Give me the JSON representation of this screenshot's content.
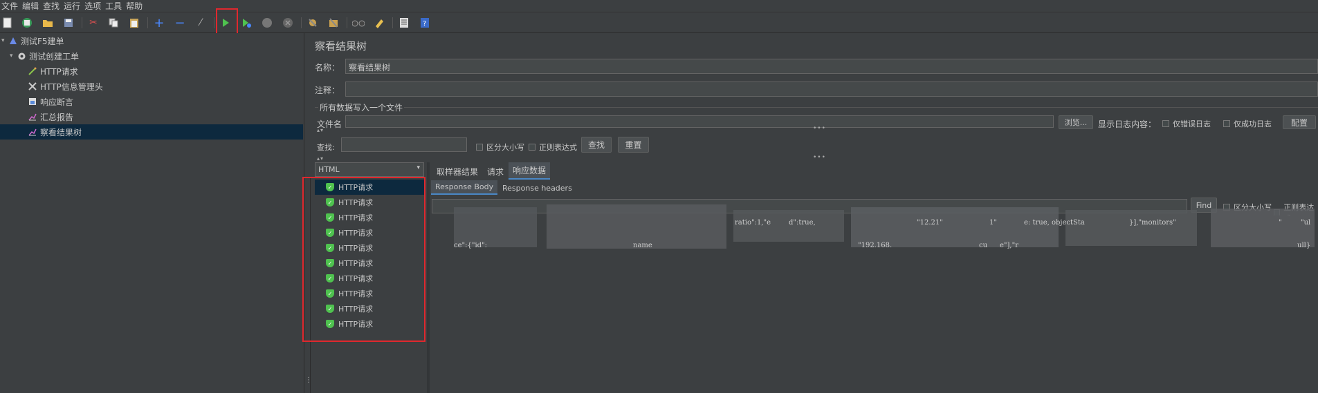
{
  "menu": [
    "文件",
    "编辑",
    "查找",
    "运行",
    "选项",
    "工具",
    "帮助"
  ],
  "toolbar": {
    "icons": [
      "new-icon",
      "templates-icon",
      "open-icon",
      "save-icon",
      "cut-icon",
      "copy-icon",
      "paste-icon",
      "expand-icon",
      "collapse-icon",
      "toggle-icon",
      "start-icon",
      "start-no-pause-icon",
      "stop-icon",
      "shutdown-icon",
      "clear-icon",
      "clear-all-icon",
      "search-icon",
      "reset-search-icon",
      "function-helper-icon",
      "help-icon"
    ]
  },
  "tree": {
    "items": [
      {
        "label": "测试F5建单",
        "level": 0,
        "icon": "test-plan-icon"
      },
      {
        "label": "测试创建工单",
        "level": 1,
        "icon": "thread-group-icon"
      },
      {
        "label": "HTTP请求",
        "level": 2,
        "icon": "http-sampler-icon"
      },
      {
        "label": "HTTP信息管理头",
        "level": 2,
        "icon": "header-manager-icon"
      },
      {
        "label": "响应断言",
        "level": 2,
        "icon": "assertion-icon"
      },
      {
        "label": "汇总报告",
        "level": 2,
        "icon": "summary-report-icon"
      },
      {
        "label": "察看结果树",
        "level": 2,
        "icon": "results-tree-icon",
        "selected": true
      }
    ]
  },
  "panel": {
    "title": "察看结果树",
    "name_label": "名称：",
    "name_value": "察看结果树",
    "comment_label": "注释：",
    "comment_value": "",
    "write_all_label": "所有数据写入一个文件",
    "filename_label": "文件名",
    "browse_label": "浏览...",
    "log_label": "显示日志内容：",
    "errors_only": "仅错误日志",
    "success_only": "仅成功日志",
    "config_label": "配置",
    "search_label": "查找:",
    "case_sensitive": "区分大小写",
    "regex": "正则表达式",
    "find_button": "查找",
    "reset_button": "重置",
    "renderer": "HTML",
    "tabs": [
      "取样器结果",
      "请求",
      "响应数据"
    ],
    "active_tab": "响应数据",
    "sub_tabs": [
      "Response Body",
      "Response headers"
    ],
    "body_find": "Find",
    "body_case": "区分大小写",
    "body_regex": "正则表达式"
  },
  "results": [
    "HTTP请求",
    "HTTP请求",
    "HTTP请求",
    "HTTP请求",
    "HTTP请求",
    "HTTP请求",
    "HTTP请求",
    "HTTP请求",
    "HTTP请求",
    "HTTP请求"
  ],
  "response_fragments": {
    "line1": [
      "ratio\":1,\"e",
      "d\":true,",
      "\"12.21\"",
      "1\"",
      "e: true, objectSta",
      "}],\"monitors\"",
      "\"",
      "\"ul"
    ],
    "line2": [
      "ce\":{\"id\":",
      "name",
      "\"192.168.",
      "cu",
      "e\"],\"r",
      "ull}"
    ]
  },
  "accent": {
    "highlight_box": "#e0282e",
    "selection": "#0d293e",
    "run_green": "#4fc24f"
  }
}
